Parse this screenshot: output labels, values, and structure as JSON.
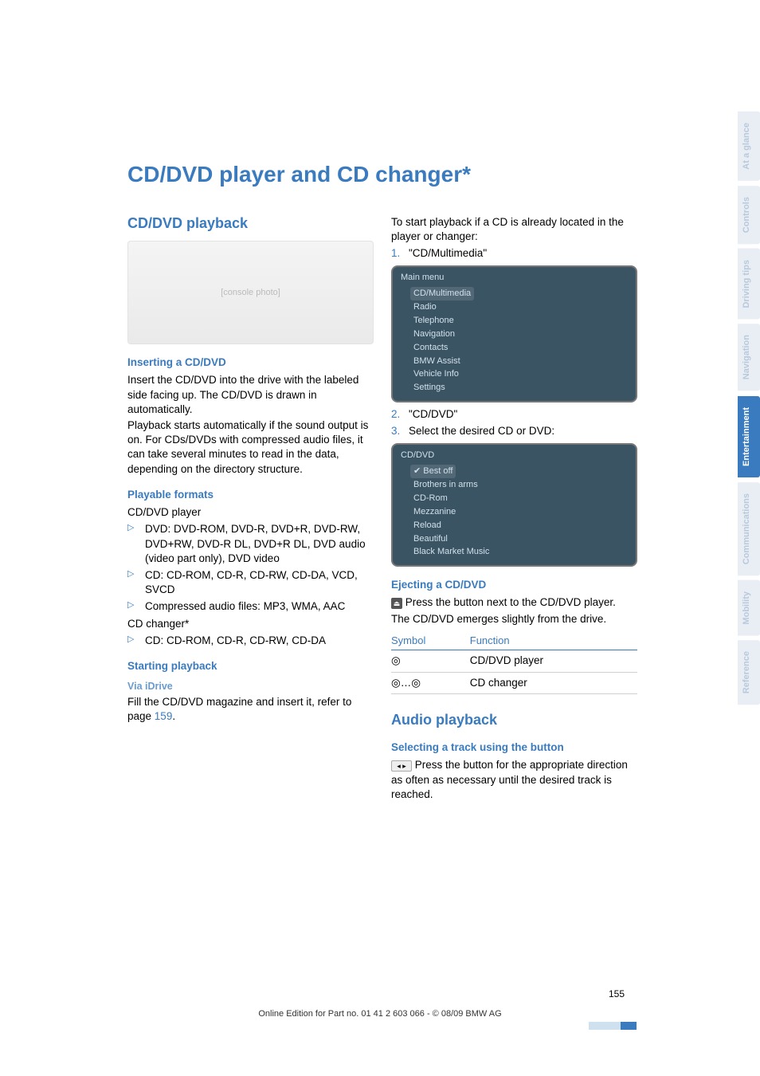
{
  "title": "CD/DVD player and CD changer*",
  "sections": {
    "playback_h": "CD/DVD playback",
    "insert_h": "Inserting a CD/DVD",
    "insert_p1": "Insert the CD/DVD into the drive with the labeled side facing up. The CD/DVD is drawn in automatically.",
    "insert_p2": "Playback starts automatically if the sound output is on. For CDs/DVDs with compressed audio files, it can take several minutes to read in the data, depending on the directory structure.",
    "formats_h": "Playable formats",
    "formats_sub": "CD/DVD player",
    "formats_items": [
      "DVD: DVD-ROM, DVD-R, DVD+R, DVD-RW, DVD+RW, DVD-R DL, DVD+R DL, DVD audio (video part only), DVD video",
      "CD: CD-ROM, CD-R, CD-RW, CD-DA, VCD, SVCD",
      "Compressed audio files: MP3, WMA, AAC"
    ],
    "changer_label": "CD changer*",
    "changer_items": [
      "CD: CD-ROM, CD-R, CD-RW, CD-DA"
    ],
    "start_h": "Starting playback",
    "via_h": "Via iDrive",
    "via_p_a": "Fill the CD/DVD magazine and insert it, refer to page ",
    "via_p_link": "159",
    "via_p_b": ".",
    "start_intro": "To start playback if a CD is already located in the player or changer:",
    "steps": [
      "\"CD/Multimedia\"",
      "\"CD/DVD\"",
      "Select the desired CD or DVD:"
    ],
    "eject_h": "Ejecting a CD/DVD",
    "eject_p1": " Press the button next to the CD/DVD player.",
    "eject_p2": "The CD/DVD emerges slightly from the drive.",
    "table_head": {
      "sym": "Symbol",
      "fn": "Function"
    },
    "table_rows": [
      {
        "fn": "CD/DVD player"
      },
      {
        "fn": "CD changer"
      }
    ],
    "audio_h": "Audio playback",
    "sel_h": "Selecting a track using the button",
    "sel_p": " Press the button for the appropriate direction as often as necessary until the desired track is reached.",
    "menu1": {
      "title": "Main menu",
      "items": [
        "CD/Multimedia",
        "Radio",
        "Telephone",
        "Navigation",
        "Contacts",
        "BMW Assist",
        "Vehicle Info",
        "Settings"
      ],
      "sel": 0
    },
    "menu2": {
      "title": "CD/DVD",
      "items": [
        "Best off",
        "Brothers in arms",
        "CD-Rom",
        "Mezzanine",
        "Reload",
        "Beautiful",
        "Black Market Music"
      ],
      "sel": 0
    }
  },
  "tabs": [
    "At a glance",
    "Controls",
    "Driving tips",
    "Navigation",
    "Entertainment",
    "Communications",
    "Mobility",
    "Reference"
  ],
  "active_tab": 4,
  "page_number": "155",
  "footer": "Online Edition for Part no. 01 41 2 603 066 - © 08/09 BMW AG"
}
